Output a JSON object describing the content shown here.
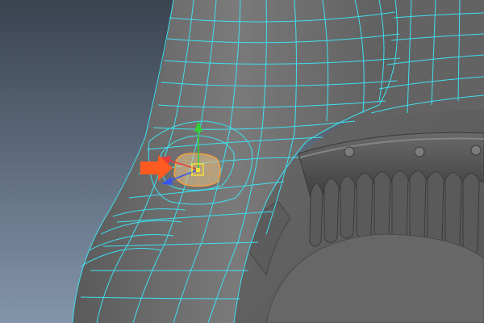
{
  "viewport": {
    "background_top": "#3a4350",
    "background_bottom": "#8395ab",
    "mesh_fill": "#6e6e6e",
    "mesh_dark": "#4c4c4c",
    "wireframe_color": "#3fe0f0",
    "selected_face_color": "#e8c48a",
    "callout_arrow_color": "#ff5a1f"
  },
  "manipulator": {
    "x_axis_color": "#e83a3a",
    "y_axis_color": "#33d133",
    "z_axis_color": "#3a55e8",
    "center_color": "#f0e040"
  },
  "icons": {
    "callout": "orange-arrow-icon",
    "manipulator": "move-manipulator-icon"
  }
}
